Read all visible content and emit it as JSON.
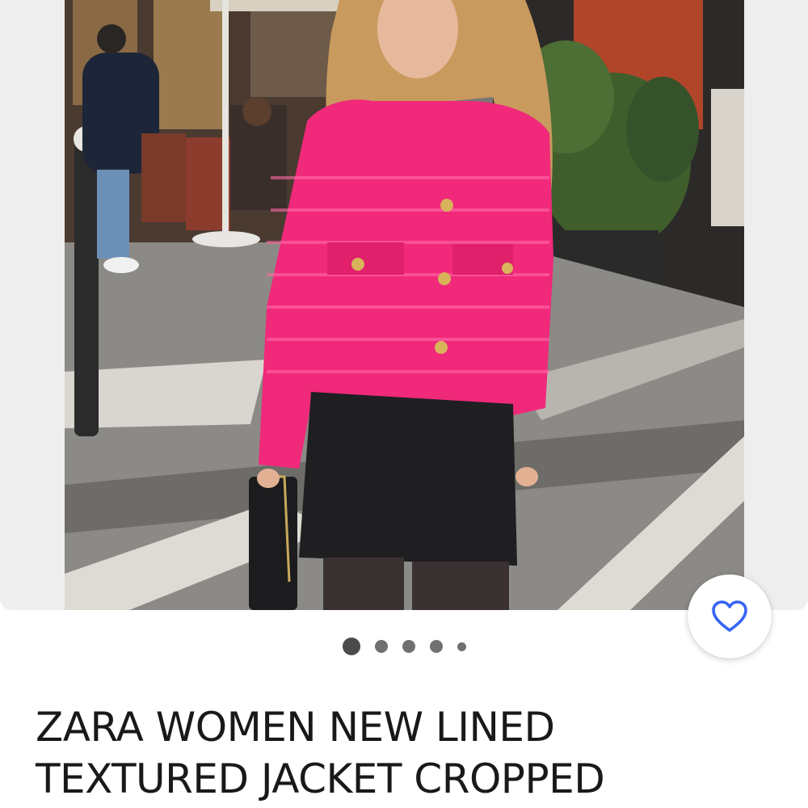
{
  "listing": {
    "title": "ZARA WOMEN NEW LINED TEXTURED JACKET CROPPED",
    "photo_description_icon": "product-photo",
    "favorite_icon": "heart-outline-icon"
  },
  "gallery": {
    "image_count": 5,
    "active_index": 0
  },
  "colors": {
    "accent": "#3665f3",
    "gallery_background": "#eeeeee",
    "title_text": "#191919",
    "dot_active": "#4a4a4a",
    "dot_inactive": "#707070"
  }
}
